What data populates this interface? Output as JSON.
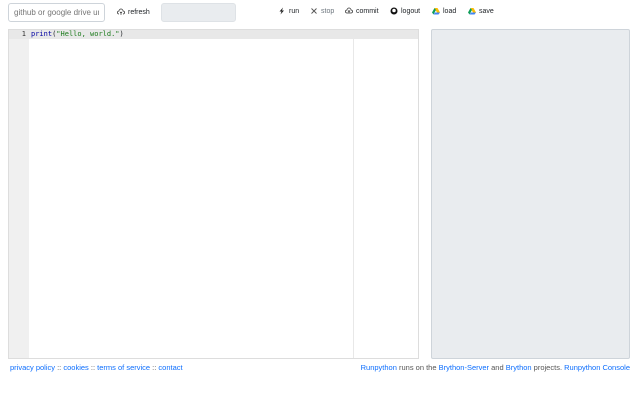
{
  "toolbar": {
    "url_placeholder": "github or google drive url",
    "refresh": "refresh",
    "run": "run",
    "stop": "stop",
    "commit": "commit",
    "logout": "logout",
    "load": "load",
    "save": "save"
  },
  "editor": {
    "line_number": "1",
    "code_fn": "print",
    "code_open": "(",
    "code_str": "\"Hello, world.\"",
    "code_close": ")"
  },
  "footer": {
    "privacy": "privacy policy",
    "sep1": " :: ",
    "cookies": "cookies",
    "sep2": " :: ",
    "terms": "terms of service",
    "sep3": " :: ",
    "contact": "contact",
    "runpython": "Runpython",
    "runs_on": " runs on the ",
    "brython_server": "Brython-Server",
    "and": " and ",
    "brython": "Brython",
    "projects": " projects. ",
    "console": "Runpython Console"
  }
}
